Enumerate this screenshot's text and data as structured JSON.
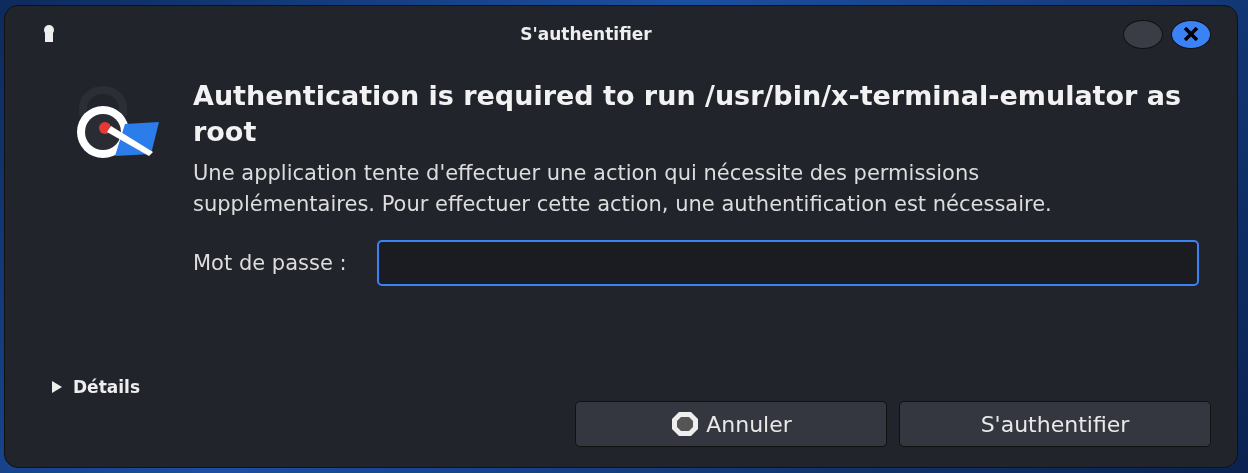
{
  "window": {
    "title": "S'authentifier"
  },
  "heading": "Authentication is required to run /usr/bin/x-terminal-emulator as root",
  "message": "Une application tente d'effectuer une action qui nécessite des permissions supplémentaires. Pour effectuer cette action, une authentification est nécessaire.",
  "password": {
    "label": "Mot de passe :"
  },
  "details": {
    "label": "Détails",
    "expanded": false
  },
  "buttons": [
    {
      "label": "Annuler",
      "kind": "cancel"
    },
    {
      "label": "S'authentifier",
      "kind": "confirm"
    }
  ]
}
